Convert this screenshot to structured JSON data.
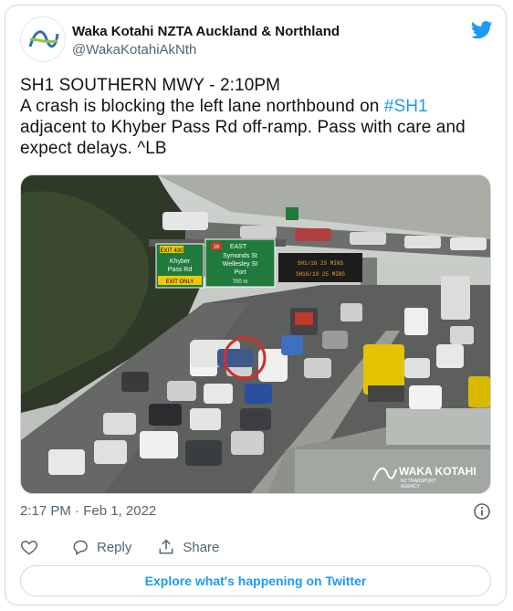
{
  "author": {
    "name": "Waka Kotahi NZTA Auckland & Northland",
    "handle": "@WakaKotahiAkNth",
    "avatar_icon": "waka-kotahi-logo-icon"
  },
  "tweet": {
    "line1": "SH1 SOUTHERN MWY - 2:10PM",
    "text_before_hashtag": "A crash is blocking the left lane northbound on ",
    "hashtag": "#SH1",
    "text_after_hashtag": "adjacent to Khyber Pass Rd off-ramp. Pass with care and expect delays. ^LB"
  },
  "media": {
    "signs": {
      "exit_number": "EXIT 430",
      "exit_line1": "Khyber",
      "exit_line2": "Pass Rd",
      "exit_only": "EXIT ONLY",
      "route": "16",
      "direction": "EAST",
      "dest1": "Symonds St",
      "dest2": "Wellesley St",
      "dest3": "Port",
      "distance": "700 m",
      "vms_line1": "SH1/16 25 MINS",
      "vms_line2": "SH16/10 25 MINS"
    },
    "watermark": {
      "brand": "WAKA KOTAHI",
      "sub1": "NZ TRANSPORT",
      "sub2": "AGENCY"
    }
  },
  "meta": {
    "timestamp": "2:17 PM · Feb 1, 2022"
  },
  "actions": {
    "reply": "Reply",
    "share": "Share"
  },
  "explore_label": "Explore what's happening on Twitter",
  "colors": {
    "twitter_blue": "#1d9bf0",
    "sign_green": "#1f7a3c",
    "exit_yellow": "#f2c800"
  }
}
